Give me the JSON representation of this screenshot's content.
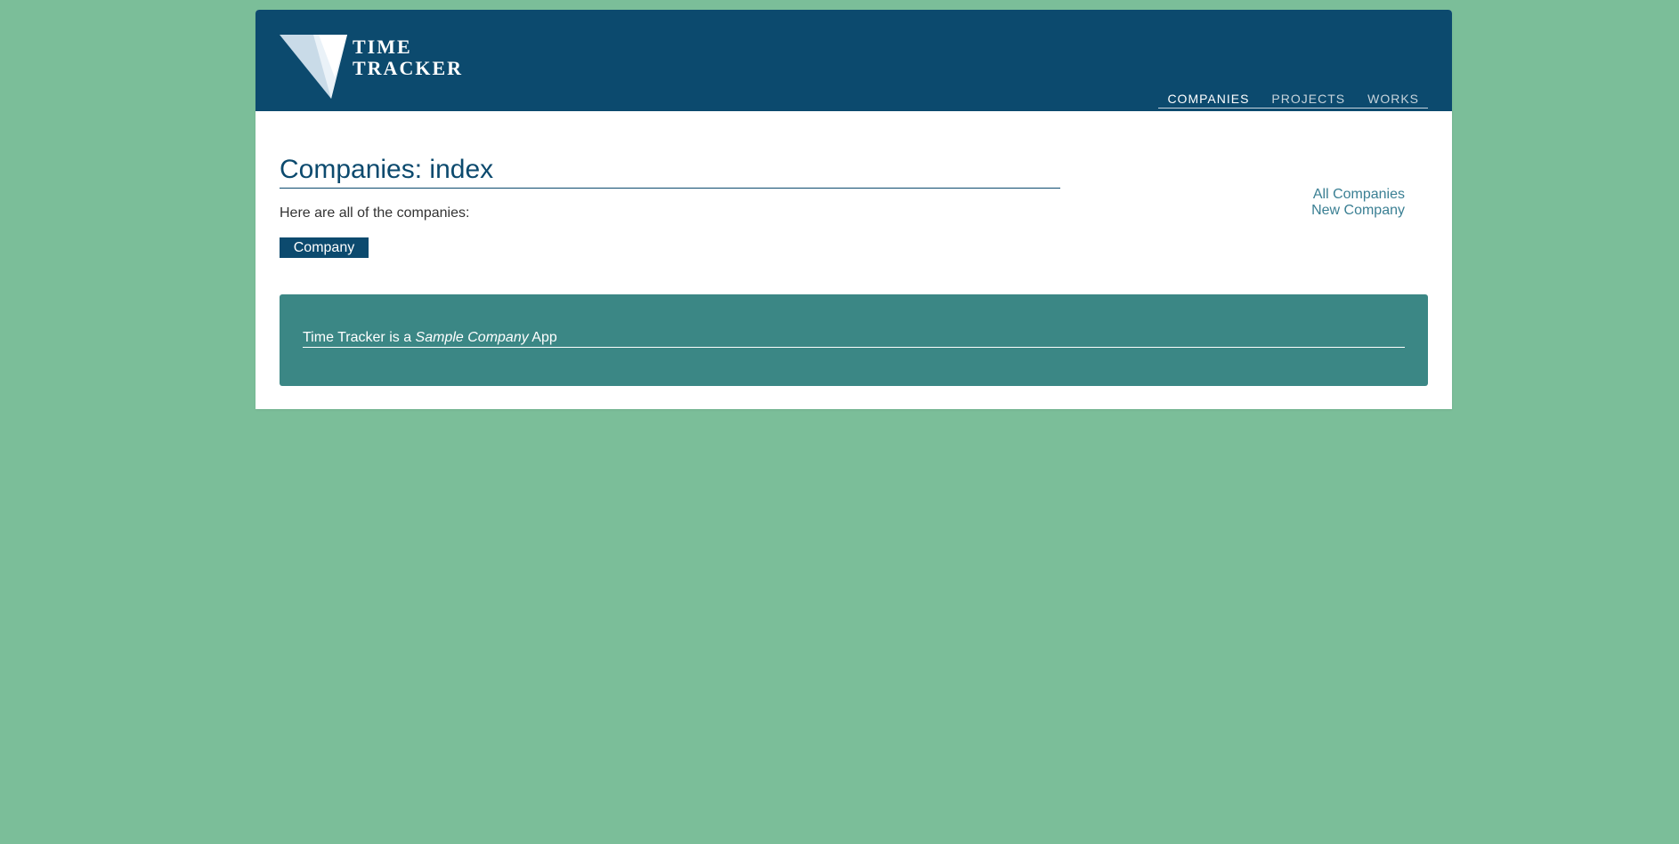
{
  "header": {
    "logo": {
      "line1": "TIME",
      "line2": "TRACKER"
    },
    "nav": [
      {
        "label": "COMPANIES",
        "active": true
      },
      {
        "label": "PROJECTS",
        "active": false
      },
      {
        "label": "WORKS",
        "active": false
      }
    ]
  },
  "main": {
    "title": "Companies: index",
    "intro": "Here are all of the companies:",
    "company_button": "Company"
  },
  "sidebar": {
    "links": [
      "All Companies",
      "New Company"
    ]
  },
  "footer": {
    "prefix": "Time Tracker is a ",
    "emphasis": "Sample Company",
    "suffix": " App"
  },
  "colors": {
    "background": "#7bbe99",
    "header": "#0c4a6e",
    "footer": "#3b8785",
    "link": "#3a7f93"
  }
}
